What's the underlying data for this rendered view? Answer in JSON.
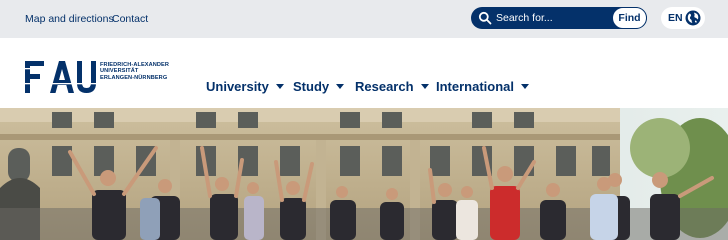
{
  "topbar": {
    "links": [
      "Map and directions",
      "Contact"
    ],
    "search": {
      "placeholder": "Search for...",
      "button_label": "Find"
    },
    "language": {
      "code": "EN"
    }
  },
  "header": {
    "logo": {
      "mark": "FAU",
      "lines": [
        "FRIEDRICH-ALEXANDER",
        "UNIVERSITÄT",
        "ERLANGEN-NÜRNBERG"
      ]
    },
    "nav": [
      "University",
      "Study",
      "Research",
      "International"
    ]
  },
  "colors": {
    "brand_blue": "#04316a",
    "topbar_bg": "#e8eaed"
  },
  "icons": [
    "search-icon",
    "globe-icon",
    "chevron-down-icon"
  ]
}
